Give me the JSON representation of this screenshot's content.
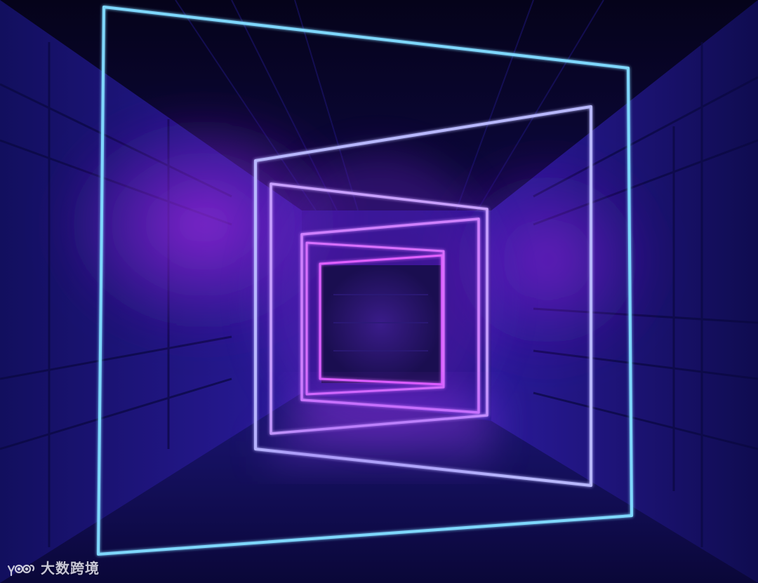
{
  "scene": {
    "subject": "neon-frame-corridor",
    "colors": {
      "background_dark": "#07052a",
      "wall_blue": "#1a1680",
      "haze_purple": "#7a1ec8",
      "neon_cyan": "#7fd8ff",
      "neon_lavender": "#c8a8ff",
      "neon_magenta": "#e060ff"
    }
  },
  "watermark": {
    "text": "大数跨境",
    "logo_icon": "mascot-logo-icon"
  }
}
